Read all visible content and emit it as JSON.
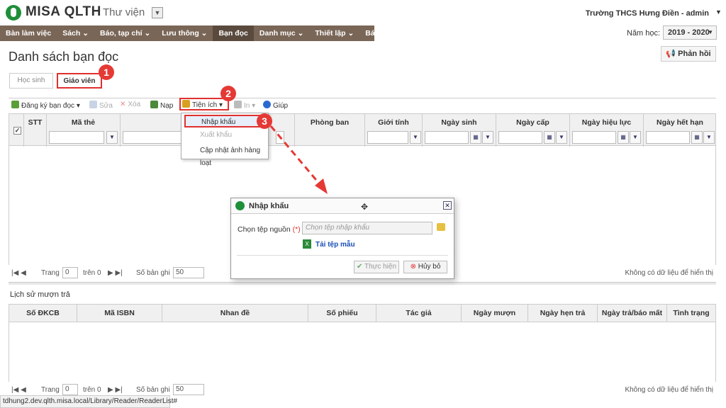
{
  "app": {
    "brand": "MISA QLTH",
    "module": "Thư viện",
    "school_user": "Trường THCS Hưng Điền - admin"
  },
  "nav": [
    {
      "label": "Bàn làm việc"
    },
    {
      "label": "Sách ⌄"
    },
    {
      "label": "Báo, tạp chí ⌄"
    },
    {
      "label": "Lưu thông ⌄"
    },
    {
      "label": "Bạn đọc",
      "active": true
    },
    {
      "label": "Danh mục ⌄"
    },
    {
      "label": "Thiết lập ⌄"
    },
    {
      "label": "Báo cáo"
    }
  ],
  "year": {
    "label": "Năm học:",
    "value": "2019 - 2020"
  },
  "page": {
    "title": "Danh sách bạn đọc",
    "feedback": "Phản hồi"
  },
  "tabs": {
    "students": "Học sinh",
    "teachers": "Giáo viên"
  },
  "badges": {
    "one": "1",
    "two": "2",
    "three": "3"
  },
  "toolbar": {
    "register": "Đăng ký bạn đọc",
    "edit": "Sửa",
    "delete": "Xóa",
    "load": "Nạp",
    "utilities": "Tiện ích",
    "print": "In",
    "help": "Giúp"
  },
  "menu": {
    "import": "Nhập khẩu",
    "export": "Xuất khẩu",
    "update_photos": "Cập nhật ảnh hàng loạt"
  },
  "grid": {
    "columns": {
      "stt": "STT",
      "code": "Mã thẻ",
      "dept": "Phòng ban",
      "gender": "Giới tính",
      "dob": "Ngày sinh",
      "issue": "Ngày cấp",
      "effective": "Ngày hiệu lực",
      "expiry": "Ngày hết hạn"
    }
  },
  "pager": {
    "page": "Trang",
    "page_value": "0",
    "of": "trên 0",
    "records": "Số bản ghi",
    "records_value": "50",
    "empty": "Không có dữ liệu để hiển thị"
  },
  "history": {
    "title": "Lịch sử mượn trả",
    "columns": {
      "reg": "Số ĐKCB",
      "isbn": "Mã ISBN",
      "name": "Nhan đề",
      "slip": "Số phiếu",
      "author": "Tác giả",
      "borrow": "Ngày mượn",
      "due": "Ngày hẹn trả",
      "ret": "Ngày trả/báo mất",
      "status": "Tình trạng"
    }
  },
  "dialog": {
    "title": "Nhập khẩu",
    "source_label": "Chọn tệp nguồn",
    "required": "(*)",
    "source_placeholder": "Chọn tệp nhập khẩu",
    "template_link": "Tải tệp mẫu",
    "execute": "Thực hiện",
    "cancel": "Hủy bỏ"
  },
  "statusbar": {
    "url": "tdhung2.dev.qlth.misa.local/Library/Reader/ReaderList#"
  },
  "colors": {
    "nav": "#7a6657",
    "nav_active": "#5a4a3e",
    "highlight": "#e03030",
    "link": "#1a4fb5",
    "brand_green": "#1f8f3a"
  }
}
